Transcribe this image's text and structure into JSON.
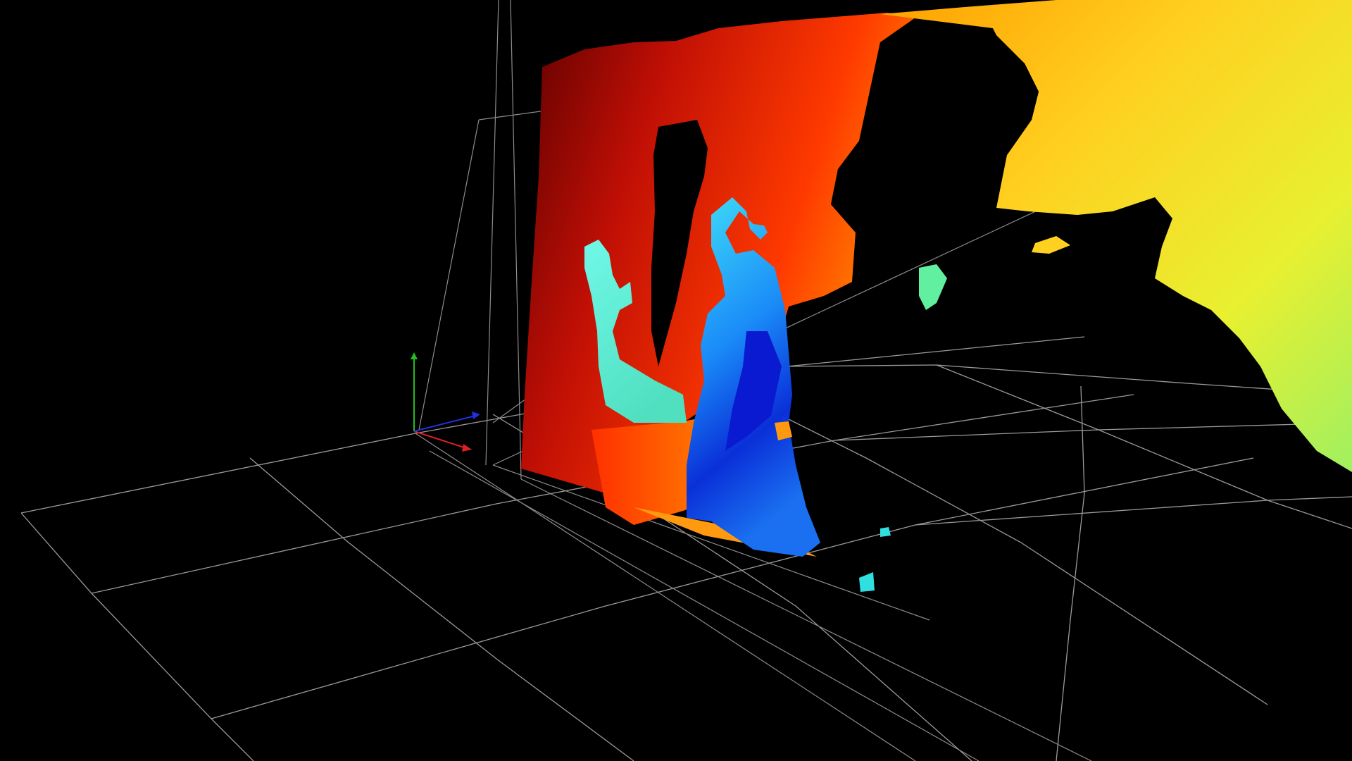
{
  "viewer": {
    "background_color": "#000000",
    "grid_line_color": "#9a9a9a",
    "frustum_line_color": "#8c8c8c",
    "colormap": "jet",
    "axes": {
      "x_color": "#e02020",
      "y_color": "#20c020",
      "z_color": "#2030e0"
    }
  },
  "point_cloud": {
    "regions": [
      {
        "name": "background-wall",
        "depth_color": "#d41a0a"
      },
      {
        "name": "background-wall-dark",
        "depth_color": "#6a0000"
      },
      {
        "name": "background-wall-orange",
        "depth_color": "#ff7a00"
      },
      {
        "name": "far-wall",
        "depth_color": "#ffd21c"
      },
      {
        "name": "far-wall-green",
        "depth_color": "#c8f040"
      },
      {
        "name": "person-arm",
        "depth_color": "#60f0d0"
      },
      {
        "name": "person-head",
        "depth_color": "#30c8f8"
      },
      {
        "name": "person-body",
        "depth_color": "#1a6cf0"
      },
      {
        "name": "person-core",
        "depth_color": "#0a20d0"
      }
    ]
  }
}
